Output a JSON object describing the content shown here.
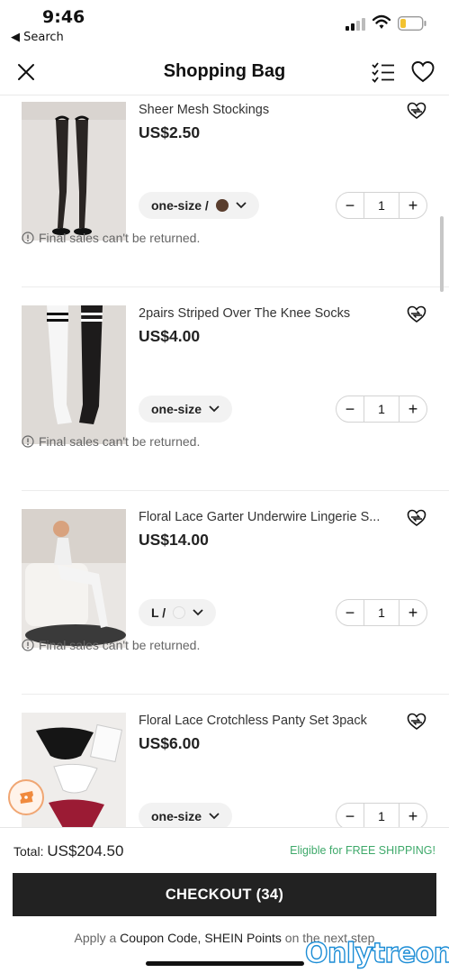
{
  "status_bar": {
    "time": "9:46",
    "back_label": "◀ Search"
  },
  "header": {
    "title": "Shopping Bag"
  },
  "items": [
    {
      "title": "Sheer Mesh Stockings",
      "price": "US$2.50",
      "variant": "one-size /",
      "swatch_color": "#5a3e2e",
      "quantity": "1",
      "notice": "Final sales can't be returned."
    },
    {
      "title": "2pairs Striped Over The Knee Socks",
      "price": "US$4.00",
      "variant": "one-size",
      "swatch_color": "",
      "quantity": "1",
      "notice": "Final sales can't be returned."
    },
    {
      "title": "Floral Lace Garter Underwire Lingerie S...",
      "price": "US$14.00",
      "variant": "L /",
      "swatch_color": "#f4f4f4",
      "quantity": "1",
      "notice": "Final sales can't be returned."
    },
    {
      "title": "Floral Lace Crotchless Panty Set 3pack",
      "price": "US$6.00",
      "variant": "one-size",
      "swatch_color": "",
      "quantity": "1",
      "notice": ""
    }
  ],
  "footer": {
    "total_label": "Total:",
    "total_value": "US$204.50",
    "shipping": "Eligible for FREE SHIPPING!",
    "checkout_label": "CHECKOUT (34)",
    "coupon_prefix": "Apply a",
    "coupon_highlight": "Coupon Code, SHEIN Points",
    "coupon_suffix": "on the next step"
  },
  "watermark": "Onlytreon",
  "colors": {
    "accent_dark": "#222222",
    "shipping_green": "#3ea96a",
    "watermark_blue": "#1c8dd6"
  }
}
